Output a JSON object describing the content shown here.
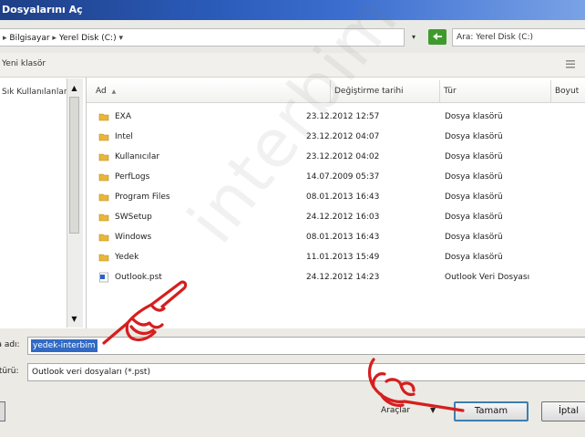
{
  "window": {
    "title": "Dosyalarını Aç"
  },
  "address": {
    "part1": "Bilgisayar",
    "separator": "▸",
    "part2": "Yerel Disk (C:)",
    "drop": "▾"
  },
  "search": {
    "placeholder": "Ara: Yerel Disk (C:)"
  },
  "toolbar": {
    "new_folder": "Yeni klasör"
  },
  "nav": {
    "item": "Sık Kullanılanlar",
    "up": "▲",
    "down": "▼"
  },
  "columns": {
    "name": "Ad",
    "sort_indicator": "▲",
    "date": "Değiştirme tarihi",
    "type": "Tür",
    "size": "Boyut"
  },
  "files": [
    {
      "name": "EXA",
      "date": "23.12.2012 12:57",
      "type": "Dosya klasörü",
      "icon": "folder-icon"
    },
    {
      "name": "Intel",
      "date": "23.12.2012 04:07",
      "type": "Dosya klasörü",
      "icon": "folder-icon"
    },
    {
      "name": "Kullanıcılar",
      "date": "23.12.2012 04:02",
      "type": "Dosya klasörü",
      "icon": "folder-icon"
    },
    {
      "name": "PerfLogs",
      "date": "14.07.2009 05:37",
      "type": "Dosya klasörü",
      "icon": "folder-icon"
    },
    {
      "name": "Program Files",
      "date": "08.01.2013 16:43",
      "type": "Dosya klasörü",
      "icon": "folder-icon"
    },
    {
      "name": "SWSetup",
      "date": "24.12.2012 16:03",
      "type": "Dosya klasörü",
      "icon": "folder-icon"
    },
    {
      "name": "Windows",
      "date": "08.01.2013 16:43",
      "type": "Dosya klasörü",
      "icon": "folder-icon"
    },
    {
      "name": "Yedek",
      "date": "11.01.2013 15:49",
      "type": "Dosya klasörü",
      "icon": "folder-icon"
    },
    {
      "name": "Outlook.pst",
      "date": "24.12.2012 14:23",
      "type": "Outlook Veri Dosyası",
      "icon": "outlook-file-icon"
    }
  ],
  "filename": {
    "label": "Dosya adı:",
    "value": "yedek-interbim"
  },
  "filetype": {
    "label": "Dosya türü:",
    "value": "Outlook veri dosyaları (*.pst)"
  },
  "buttons": {
    "tools": "Araçlar",
    "tools_arrow": "▼",
    "ok": "Tamam",
    "cancel": "İptal"
  },
  "watermark": "interbim",
  "colors": {
    "title_bar": "#2a5ab8",
    "selection": "#316ac5",
    "annotation_hand": "#d61e1e",
    "folder": "#e8b73a"
  }
}
